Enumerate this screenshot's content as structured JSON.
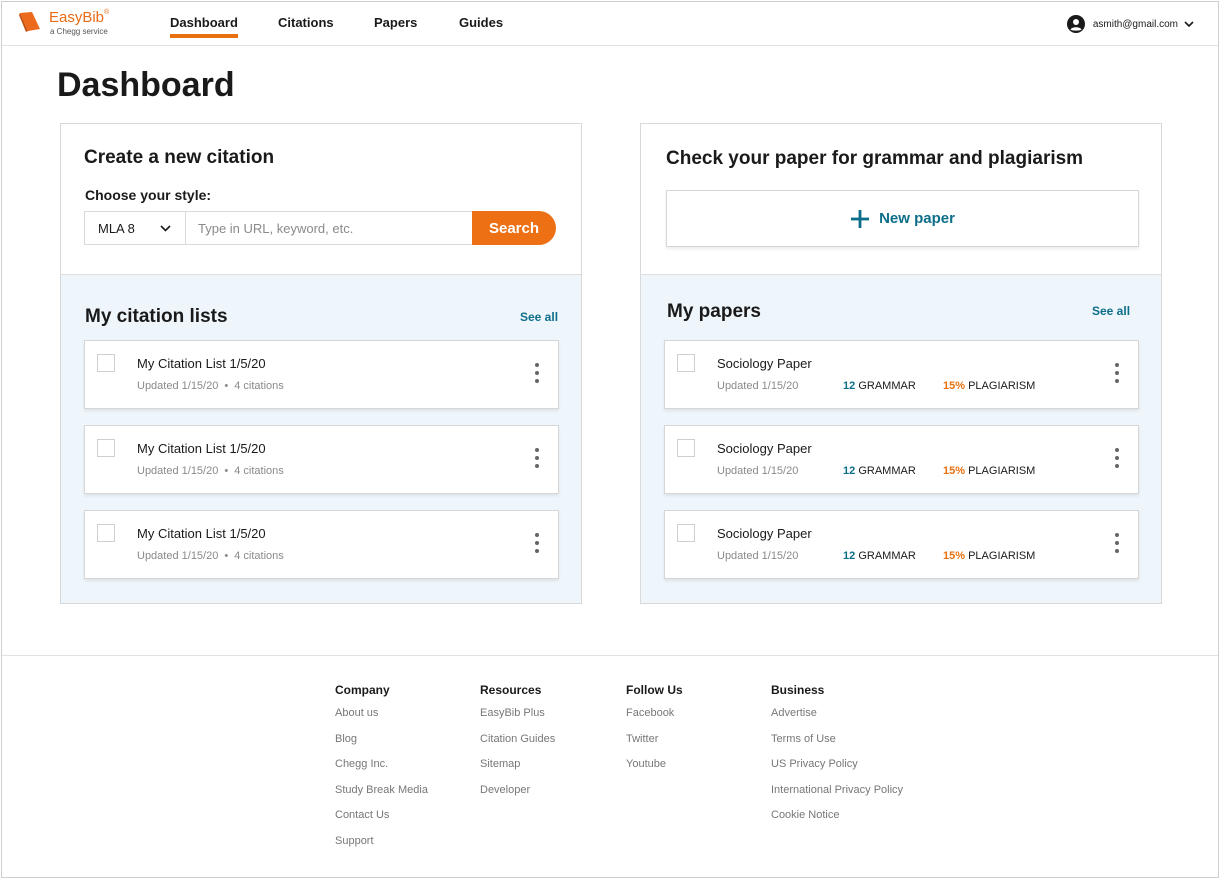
{
  "brand": {
    "name": "EasyBib",
    "tagline": "a Chegg service",
    "trademark": "®"
  },
  "nav": {
    "items": [
      {
        "label": "Dashboard",
        "active": true
      },
      {
        "label": "Citations",
        "active": false
      },
      {
        "label": "Papers",
        "active": false
      },
      {
        "label": "Guides",
        "active": false
      }
    ]
  },
  "account": {
    "email": "asmith@gmail.com"
  },
  "page": {
    "title": "Dashboard"
  },
  "citation_card": {
    "heading": "Create a new citation",
    "style_label": "Choose your style:",
    "style_value": "MLA 8",
    "search_placeholder": "Type in URL, keyword, etc.",
    "search_button": "Search",
    "lists_title": "My citation lists",
    "see_all": "See all",
    "lists": [
      {
        "title": "My Citation List 1/5/20",
        "updated": "Updated 1/15/20",
        "count": "4 citations"
      },
      {
        "title": "My Citation List 1/5/20",
        "updated": "Updated 1/15/20",
        "count": "4 citations"
      },
      {
        "title": "My Citation List 1/5/20",
        "updated": "Updated 1/15/20",
        "count": "4 citations"
      }
    ]
  },
  "paper_card": {
    "heading": "Check your paper for grammar and plagiarism",
    "new_paper": "New paper",
    "papers_title": "My papers",
    "see_all": "See all",
    "papers": [
      {
        "title": "Sociology Paper",
        "updated": "Updated 1/15/20",
        "grammar_count": "12",
        "grammar_label": "GRAMMAR",
        "plagiarism_pct": "15%",
        "plagiarism_label": "PLAGIARISM"
      },
      {
        "title": "Sociology Paper",
        "updated": "Updated 1/15/20",
        "grammar_count": "12",
        "grammar_label": "GRAMMAR",
        "plagiarism_pct": "15%",
        "plagiarism_label": "PLAGIARISM"
      },
      {
        "title": "Sociology Paper",
        "updated": "Updated 1/15/20",
        "grammar_count": "12",
        "grammar_label": "GRAMMAR",
        "plagiarism_pct": "15%",
        "plagiarism_label": "PLAGIARISM"
      }
    ]
  },
  "footer": {
    "columns": [
      {
        "heading": "Company",
        "links": [
          "About us",
          "Blog",
          "Chegg Inc.",
          "Study Break Media",
          "Contact Us",
          "Support"
        ]
      },
      {
        "heading": "Resources",
        "links": [
          "EasyBib Plus",
          "Citation Guides",
          "Sitemap",
          "Developer"
        ]
      },
      {
        "heading": "Follow Us",
        "links": [
          "Facebook",
          "Twitter",
          "Youtube"
        ]
      },
      {
        "heading": "Business",
        "links": [
          "Advertise",
          "Terms of Use",
          "US Privacy Policy",
          "International Privacy Policy",
          "Cookie Notice"
        ]
      }
    ]
  },
  "colors": {
    "accent_orange": "#ed7015",
    "link_teal": "#0d6e8a",
    "panel_blue": "#eef6fc"
  },
  "icons": [
    "easybib-logo-icon",
    "account-circle-icon",
    "chevron-down-icon",
    "plus-icon",
    "kebab-menu-icon"
  ]
}
